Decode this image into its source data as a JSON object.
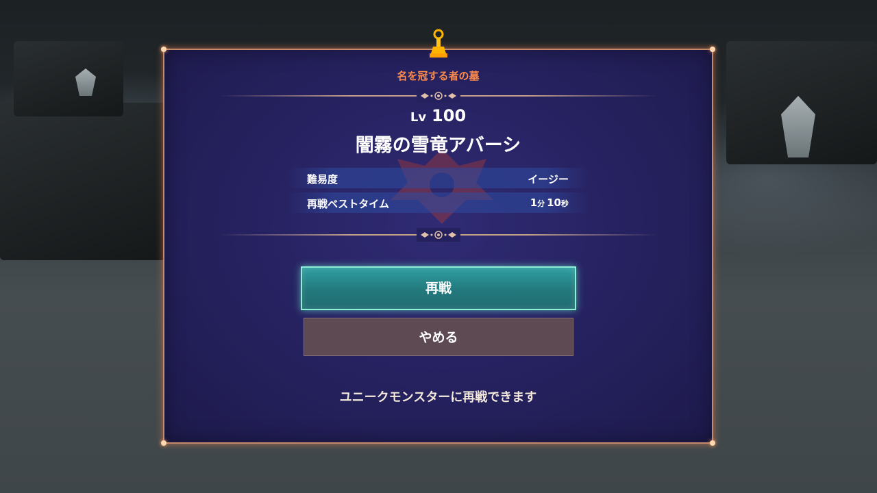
{
  "dialog": {
    "subtitle": "名を冠する者の墓",
    "level_prefix": "Lv",
    "level_value": "100",
    "boss_name": "闇霧の雪竜アバーシ",
    "stats": [
      {
        "label": "難易度",
        "value": "イージー"
      },
      {
        "label": "再戦ベストタイム",
        "min": "1",
        "min_unit": "分",
        "sec": "10",
        "sec_unit": "秒"
      }
    ],
    "buttons": {
      "rematch": "再戦",
      "quit": "やめる"
    },
    "hint": "ユニークモンスターに再戦できます"
  },
  "colors": {
    "panel": "#25215e",
    "border": "#c58a6c",
    "subtitle": "#ff8a4a",
    "rematch_button": "#23797d",
    "quit_button": "#5e4a52"
  },
  "icons": [
    "trophy-icon",
    "divider-ornament-icon",
    "boss-emblem-icon"
  ]
}
